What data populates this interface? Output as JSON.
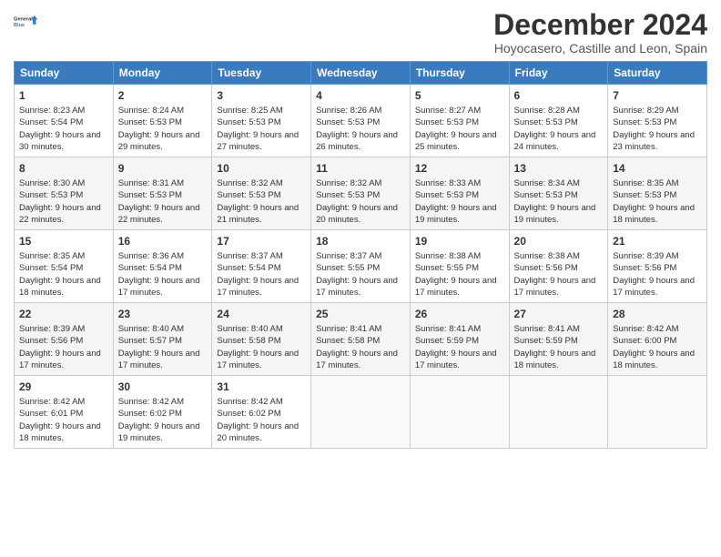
{
  "logo": {
    "line1": "General",
    "line2": "Blue"
  },
  "title": "December 2024",
  "subtitle": "Hoyocasero, Castille and Leon, Spain",
  "days_of_week": [
    "Sunday",
    "Monday",
    "Tuesday",
    "Wednesday",
    "Thursday",
    "Friday",
    "Saturday"
  ],
  "weeks": [
    [
      {
        "day": "1",
        "sunrise": "Sunrise: 8:23 AM",
        "sunset": "Sunset: 5:54 PM",
        "daylight": "Daylight: 9 hours and 30 minutes."
      },
      {
        "day": "2",
        "sunrise": "Sunrise: 8:24 AM",
        "sunset": "Sunset: 5:53 PM",
        "daylight": "Daylight: 9 hours and 29 minutes."
      },
      {
        "day": "3",
        "sunrise": "Sunrise: 8:25 AM",
        "sunset": "Sunset: 5:53 PM",
        "daylight": "Daylight: 9 hours and 27 minutes."
      },
      {
        "day": "4",
        "sunrise": "Sunrise: 8:26 AM",
        "sunset": "Sunset: 5:53 PM",
        "daylight": "Daylight: 9 hours and 26 minutes."
      },
      {
        "day": "5",
        "sunrise": "Sunrise: 8:27 AM",
        "sunset": "Sunset: 5:53 PM",
        "daylight": "Daylight: 9 hours and 25 minutes."
      },
      {
        "day": "6",
        "sunrise": "Sunrise: 8:28 AM",
        "sunset": "Sunset: 5:53 PM",
        "daylight": "Daylight: 9 hours and 24 minutes."
      },
      {
        "day": "7",
        "sunrise": "Sunrise: 8:29 AM",
        "sunset": "Sunset: 5:53 PM",
        "daylight": "Daylight: 9 hours and 23 minutes."
      }
    ],
    [
      {
        "day": "8",
        "sunrise": "Sunrise: 8:30 AM",
        "sunset": "Sunset: 5:53 PM",
        "daylight": "Daylight: 9 hours and 22 minutes."
      },
      {
        "day": "9",
        "sunrise": "Sunrise: 8:31 AM",
        "sunset": "Sunset: 5:53 PM",
        "daylight": "Daylight: 9 hours and 22 minutes."
      },
      {
        "day": "10",
        "sunrise": "Sunrise: 8:32 AM",
        "sunset": "Sunset: 5:53 PM",
        "daylight": "Daylight: 9 hours and 21 minutes."
      },
      {
        "day": "11",
        "sunrise": "Sunrise: 8:32 AM",
        "sunset": "Sunset: 5:53 PM",
        "daylight": "Daylight: 9 hours and 20 minutes."
      },
      {
        "day": "12",
        "sunrise": "Sunrise: 8:33 AM",
        "sunset": "Sunset: 5:53 PM",
        "daylight": "Daylight: 9 hours and 19 minutes."
      },
      {
        "day": "13",
        "sunrise": "Sunrise: 8:34 AM",
        "sunset": "Sunset: 5:53 PM",
        "daylight": "Daylight: 9 hours and 19 minutes."
      },
      {
        "day": "14",
        "sunrise": "Sunrise: 8:35 AM",
        "sunset": "Sunset: 5:53 PM",
        "daylight": "Daylight: 9 hours and 18 minutes."
      }
    ],
    [
      {
        "day": "15",
        "sunrise": "Sunrise: 8:35 AM",
        "sunset": "Sunset: 5:54 PM",
        "daylight": "Daylight: 9 hours and 18 minutes."
      },
      {
        "day": "16",
        "sunrise": "Sunrise: 8:36 AM",
        "sunset": "Sunset: 5:54 PM",
        "daylight": "Daylight: 9 hours and 17 minutes."
      },
      {
        "day": "17",
        "sunrise": "Sunrise: 8:37 AM",
        "sunset": "Sunset: 5:54 PM",
        "daylight": "Daylight: 9 hours and 17 minutes."
      },
      {
        "day": "18",
        "sunrise": "Sunrise: 8:37 AM",
        "sunset": "Sunset: 5:55 PM",
        "daylight": "Daylight: 9 hours and 17 minutes."
      },
      {
        "day": "19",
        "sunrise": "Sunrise: 8:38 AM",
        "sunset": "Sunset: 5:55 PM",
        "daylight": "Daylight: 9 hours and 17 minutes."
      },
      {
        "day": "20",
        "sunrise": "Sunrise: 8:38 AM",
        "sunset": "Sunset: 5:56 PM",
        "daylight": "Daylight: 9 hours and 17 minutes."
      },
      {
        "day": "21",
        "sunrise": "Sunrise: 8:39 AM",
        "sunset": "Sunset: 5:56 PM",
        "daylight": "Daylight: 9 hours and 17 minutes."
      }
    ],
    [
      {
        "day": "22",
        "sunrise": "Sunrise: 8:39 AM",
        "sunset": "Sunset: 5:56 PM",
        "daylight": "Daylight: 9 hours and 17 minutes."
      },
      {
        "day": "23",
        "sunrise": "Sunrise: 8:40 AM",
        "sunset": "Sunset: 5:57 PM",
        "daylight": "Daylight: 9 hours and 17 minutes."
      },
      {
        "day": "24",
        "sunrise": "Sunrise: 8:40 AM",
        "sunset": "Sunset: 5:58 PM",
        "daylight": "Daylight: 9 hours and 17 minutes."
      },
      {
        "day": "25",
        "sunrise": "Sunrise: 8:41 AM",
        "sunset": "Sunset: 5:58 PM",
        "daylight": "Daylight: 9 hours and 17 minutes."
      },
      {
        "day": "26",
        "sunrise": "Sunrise: 8:41 AM",
        "sunset": "Sunset: 5:59 PM",
        "daylight": "Daylight: 9 hours and 17 minutes."
      },
      {
        "day": "27",
        "sunrise": "Sunrise: 8:41 AM",
        "sunset": "Sunset: 5:59 PM",
        "daylight": "Daylight: 9 hours and 18 minutes."
      },
      {
        "day": "28",
        "sunrise": "Sunrise: 8:42 AM",
        "sunset": "Sunset: 6:00 PM",
        "daylight": "Daylight: 9 hours and 18 minutes."
      }
    ],
    [
      {
        "day": "29",
        "sunrise": "Sunrise: 8:42 AM",
        "sunset": "Sunset: 6:01 PM",
        "daylight": "Daylight: 9 hours and 18 minutes."
      },
      {
        "day": "30",
        "sunrise": "Sunrise: 8:42 AM",
        "sunset": "Sunset: 6:02 PM",
        "daylight": "Daylight: 9 hours and 19 minutes."
      },
      {
        "day": "31",
        "sunrise": "Sunrise: 8:42 AM",
        "sunset": "Sunset: 6:02 PM",
        "daylight": "Daylight: 9 hours and 20 minutes."
      },
      null,
      null,
      null,
      null
    ]
  ]
}
